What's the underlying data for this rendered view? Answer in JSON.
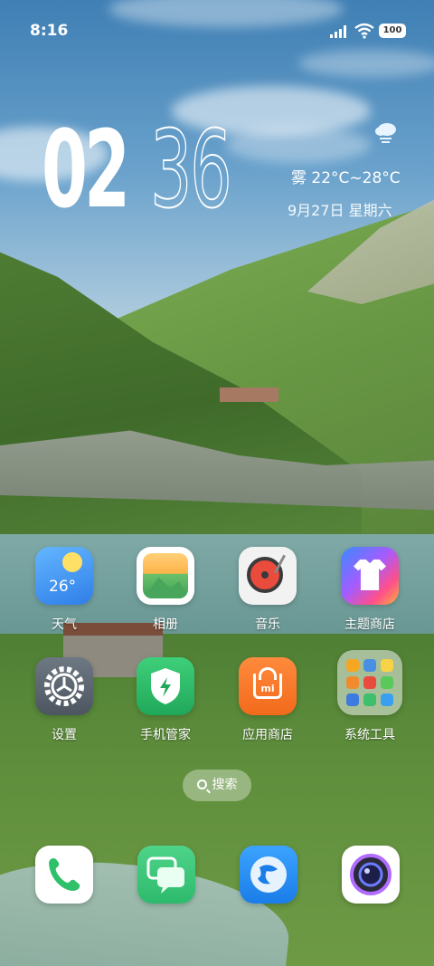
{
  "status_bar": {
    "time": "8:16",
    "battery": "100",
    "signal_icon": "cellular-signal-icon",
    "wifi_icon": "wifi-icon"
  },
  "clock_widget": {
    "hours": "02",
    "minutes": "36",
    "weather_icon": "cloud-rain-icon",
    "weather": "雾  22°C~28°C",
    "date": "9月27日 星期六"
  },
  "apps": [
    {
      "label": "天气",
      "icon": "weather-app-icon",
      "badge_text": "26°"
    },
    {
      "label": "相册",
      "icon": "gallery-app-icon"
    },
    {
      "label": "音乐",
      "icon": "music-app-icon"
    },
    {
      "label": "主题商店",
      "icon": "theme-store-app-icon"
    },
    {
      "label": "设置",
      "icon": "settings-app-icon"
    },
    {
      "label": "手机管家",
      "icon": "security-app-icon"
    },
    {
      "label": "应用商店",
      "icon": "app-store-app-icon",
      "logo_text": "mi"
    },
    {
      "label": "系统工具",
      "icon": "system-tools-folder-icon"
    }
  ],
  "search": {
    "label": "搜索",
    "icon": "search-icon"
  },
  "dock": [
    {
      "icon": "phone-app-icon"
    },
    {
      "icon": "messages-app-icon"
    },
    {
      "icon": "browser-app-icon"
    },
    {
      "icon": "camera-app-icon"
    }
  ]
}
